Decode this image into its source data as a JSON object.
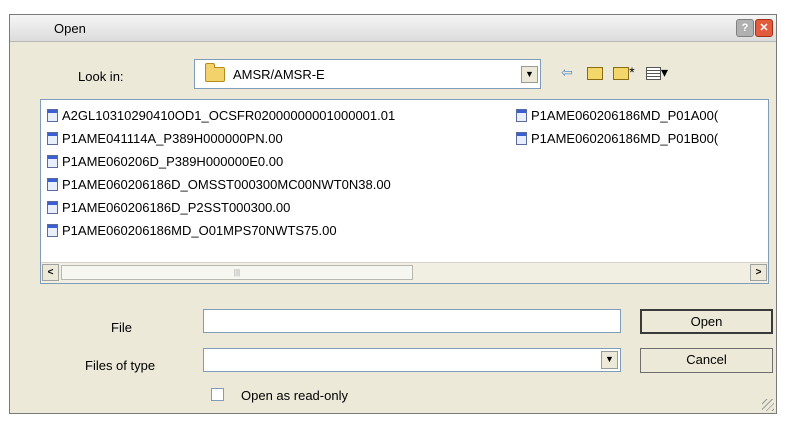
{
  "window": {
    "title": "Open"
  },
  "lookin": {
    "label": "Look in:",
    "value": "AMSR/AMSR-E"
  },
  "toolbar_icons": [
    "back-icon",
    "up-folder-icon",
    "new-folder-icon",
    "view-menu-icon"
  ],
  "files": {
    "col1": [
      "A2GL10310290410OD1_OCSFR02000000001000001.01",
      "P1AME041114A_P389H000000PN.00",
      "P1AME060206D_P389H000000E0.00",
      "P1AME060206186D_OMSST000300MC00NWT0N38.00",
      "P1AME060206186D_P2SST000300.00",
      "P1AME060206186MD_O01MPS70NWTS75.00"
    ],
    "col2": [
      "P1AME060206186MD_P01A00(",
      "P1AME060206186MD_P01B00("
    ]
  },
  "form": {
    "file_label": "File",
    "file_value": "",
    "type_label": "Files of type",
    "type_value": "",
    "readonly_label": "Open as read-only"
  },
  "buttons": {
    "open": "Open",
    "cancel": "Cancel"
  }
}
